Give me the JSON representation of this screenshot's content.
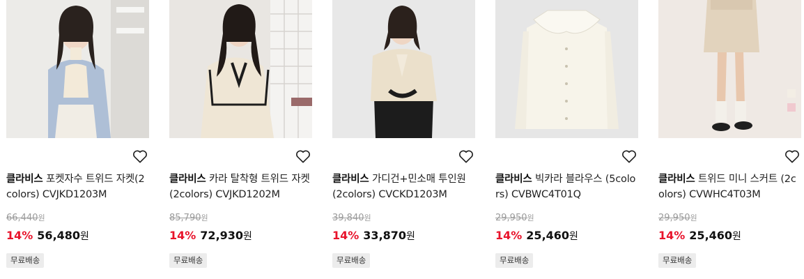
{
  "products": [
    {
      "brand": "클라비스",
      "name": "포켓자수 트위드 자켓(2colors) CVJKD1203M",
      "original_price": "66,440",
      "discount": "14%",
      "price": "56,480",
      "currency": "원",
      "shipping_badge": "무료배송",
      "image_desc": "woman in light blue tweed jacket"
    },
    {
      "brand": "클라비스",
      "name": "카라 탈착형 트위드 자켓 (2colors) CVJKD1202M",
      "original_price": "85,790",
      "discount": "14%",
      "price": "72,930",
      "currency": "원",
      "shipping_badge": "무료배송",
      "image_desc": "woman in cream tweed jacket with black trim"
    },
    {
      "brand": "클라비스",
      "name": "가디건+민소매 투인원 (2colors) CVCKD1203M",
      "original_price": "39,840",
      "discount": "14%",
      "price": "33,870",
      "currency": "원",
      "shipping_badge": "무료배송",
      "image_desc": "woman in cream cardigan"
    },
    {
      "brand": "클라비스",
      "name": "빅카라 블라우스 (5colors) CVBWC4T01Q",
      "original_price": "29,950",
      "discount": "14%",
      "price": "25,460",
      "currency": "원",
      "shipping_badge": "무료배송",
      "image_desc": "cream blouse with big collar"
    },
    {
      "brand": "클라비스",
      "name": "트위드 미니 스커트 (2colors) CVWHC4T03M",
      "original_price": "29,950",
      "discount": "14%",
      "price": "25,460",
      "currency": "원",
      "shipping_badge": "무료배송",
      "image_desc": "beige tweed mini skirt"
    }
  ],
  "colors": {
    "discount": "#e8132b",
    "badge_bg": "#ececec",
    "original_price": "#9a9a9a"
  },
  "icons": {
    "wishlist": "heart-outline-icon"
  }
}
